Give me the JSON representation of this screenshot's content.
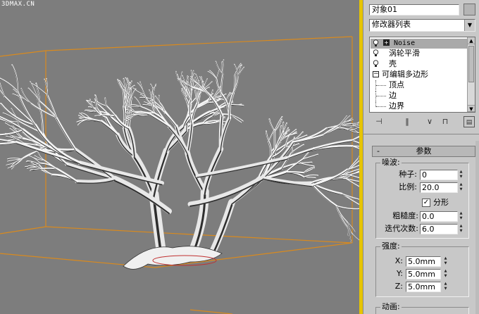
{
  "watermark": "3DMAX.CN",
  "object_name": "对象01",
  "modifier_list": "修改器列表",
  "stack": {
    "items": [
      {
        "label": "Noise",
        "selected": true
      },
      {
        "label": "涡轮平滑",
        "selected": false
      },
      {
        "label": "壳",
        "selected": false
      },
      {
        "label": "可编辑多边形",
        "selected": false
      },
      {
        "label": "顶点",
        "selected": false
      },
      {
        "label": "边",
        "selected": false
      },
      {
        "label": "边界",
        "selected": false
      }
    ]
  },
  "rollout": {
    "title": "参数",
    "noise_group": "噪波:",
    "seed_label": "种子:",
    "seed_value": "0",
    "scale_label": "比例:",
    "scale_value": "20.0",
    "fractal_label": "分形",
    "roughness_label": "粗糙度:",
    "roughness_value": "0.0",
    "iterations_label": "迭代次数:",
    "iterations_value": "6.0",
    "strength_group": "强度:",
    "x_label": "X:",
    "x_value": "5.0mm",
    "y_label": "Y:",
    "y_value": "5.0mm",
    "z_label": "Z:",
    "z_value": "5.0mm",
    "animation_group": "动画:"
  },
  "colors": {
    "viewport_bg": "#7d7d7d",
    "grid_orange": "#d98a1e",
    "active_border": "#e6c400",
    "panel_bg": "#c8c8c8"
  }
}
